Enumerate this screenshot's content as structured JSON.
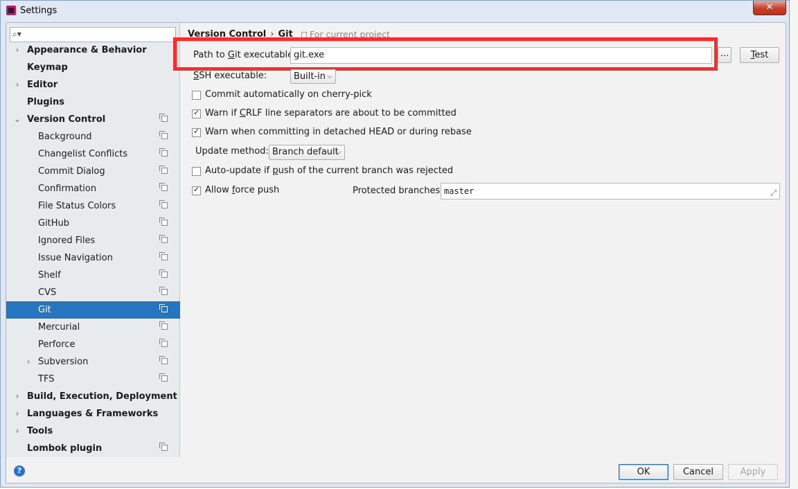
{
  "window": {
    "title": "Settings",
    "close_label": "✕"
  },
  "search": {
    "value": "",
    "placeholder": ""
  },
  "sidebar": {
    "items": [
      {
        "label": "Appearance & Behavior",
        "bold": true,
        "arrow": "›",
        "level": 0,
        "project": false
      },
      {
        "label": "Keymap",
        "bold": true,
        "arrow": "",
        "level": 0,
        "project": false
      },
      {
        "label": "Editor",
        "bold": true,
        "arrow": "›",
        "level": 0,
        "project": false
      },
      {
        "label": "Plugins",
        "bold": true,
        "arrow": "",
        "level": 0,
        "project": false
      },
      {
        "label": "Version Control",
        "bold": true,
        "arrow": "⌄",
        "level": 0,
        "project": true
      },
      {
        "label": "Background",
        "bold": false,
        "arrow": "",
        "level": 1,
        "project": true
      },
      {
        "label": "Changelist Conflicts",
        "bold": false,
        "arrow": "",
        "level": 1,
        "project": true
      },
      {
        "label": "Commit Dialog",
        "bold": false,
        "arrow": "",
        "level": 1,
        "project": true
      },
      {
        "label": "Confirmation",
        "bold": false,
        "arrow": "",
        "level": 1,
        "project": true
      },
      {
        "label": "File Status Colors",
        "bold": false,
        "arrow": "",
        "level": 1,
        "project": true
      },
      {
        "label": "GitHub",
        "bold": false,
        "arrow": "",
        "level": 1,
        "project": true
      },
      {
        "label": "Ignored Files",
        "bold": false,
        "arrow": "",
        "level": 1,
        "project": true
      },
      {
        "label": "Issue Navigation",
        "bold": false,
        "arrow": "",
        "level": 1,
        "project": true
      },
      {
        "label": "Shelf",
        "bold": false,
        "arrow": "",
        "level": 1,
        "project": true
      },
      {
        "label": "CVS",
        "bold": false,
        "arrow": "",
        "level": 1,
        "project": true
      },
      {
        "label": "Git",
        "bold": false,
        "arrow": "",
        "level": 1,
        "project": true,
        "selected": true
      },
      {
        "label": "Mercurial",
        "bold": false,
        "arrow": "",
        "level": 1,
        "project": true
      },
      {
        "label": "Perforce",
        "bold": false,
        "arrow": "",
        "level": 1,
        "project": true
      },
      {
        "label": "Subversion",
        "bold": false,
        "arrow": "›",
        "level": 1,
        "project": true
      },
      {
        "label": "TFS",
        "bold": false,
        "arrow": "",
        "level": 1,
        "project": true
      },
      {
        "label": "Build, Execution, Deployment",
        "bold": true,
        "arrow": "›",
        "level": 0,
        "project": false
      },
      {
        "label": "Languages & Frameworks",
        "bold": true,
        "arrow": "›",
        "level": 0,
        "project": false
      },
      {
        "label": "Tools",
        "bold": true,
        "arrow": "›",
        "level": 0,
        "project": false
      },
      {
        "label": "Lombok plugin",
        "bold": true,
        "arrow": "",
        "level": 0,
        "project": true
      }
    ]
  },
  "breadcrumb": {
    "parent": "Version Control",
    "separator": "›",
    "current": "Git",
    "note": "For current project"
  },
  "git": {
    "path_label_pre": "Path to ",
    "path_label_u": "G",
    "path_label_post": "it executable:",
    "path_value": "git.exe",
    "browse_label": "...",
    "test_label_u": "T",
    "test_label_post": "est",
    "ssh_label_u": "S",
    "ssh_label_post": "SH executable:",
    "ssh_value": "Built-in",
    "commit_auto_label": "Commit automatically on cherry-pick",
    "commit_auto_checked": false,
    "crlf_label_pre": "Warn if ",
    "crlf_label_u": "C",
    "crlf_label_post": "RLF line separators are about to be committed",
    "crlf_checked": true,
    "detached_label": "Warn when committing in detached HEAD or during rebase",
    "detached_checked": true,
    "update_method_label": "Update method:",
    "update_method_value": "Branch default",
    "auto_update_label_pre": "Auto-update if ",
    "auto_update_label_u": "p",
    "auto_update_label_post": "ush of the current branch was rejected",
    "auto_update_checked": false,
    "force_push_label_pre": "Allow ",
    "force_push_label_u": "f",
    "force_push_label_post": "orce push",
    "force_push_checked": true,
    "protected_label": "Protected branches:",
    "protected_value": "master"
  },
  "footer": {
    "help": "?",
    "ok": "OK",
    "cancel": "Cancel",
    "apply": "Apply"
  }
}
